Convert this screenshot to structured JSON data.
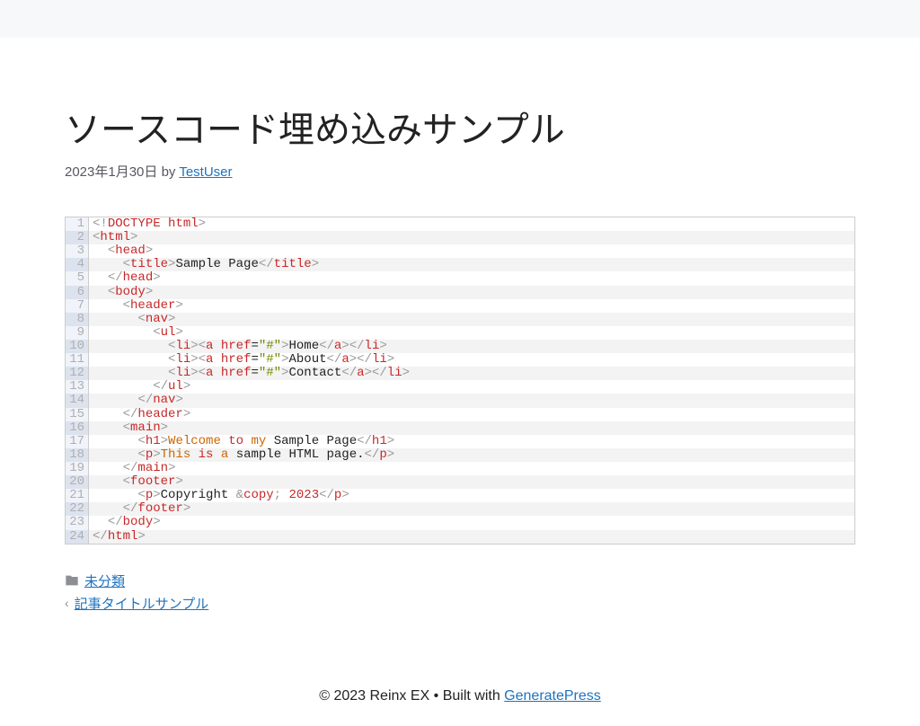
{
  "article": {
    "title": "ソースコード埋め込みサンプル",
    "date": "2023年1月30日",
    "by_label": "by",
    "author": "TestUser"
  },
  "footer_meta": {
    "category": "未分類",
    "prev_post": "記事タイトルサンプル"
  },
  "site_footer": {
    "copyright": "© 2023 Reinx EX",
    "built_with": "Built with",
    "theme": "GeneratePress"
  },
  "code": {
    "line_count": 24,
    "tokens": [
      [
        [
          "ang",
          "<!"
        ],
        [
          "red",
          "DOCTYPE"
        ],
        [
          "plain",
          " "
        ],
        [
          "attr",
          "html"
        ],
        [
          "ang",
          ">"
        ]
      ],
      [
        [
          "ang",
          "<"
        ],
        [
          "red",
          "html"
        ],
        [
          "ang",
          ">"
        ]
      ],
      [
        [
          "plain",
          "  "
        ],
        [
          "ang",
          "<"
        ],
        [
          "red",
          "head"
        ],
        [
          "ang",
          ">"
        ]
      ],
      [
        [
          "plain",
          "    "
        ],
        [
          "ang",
          "<"
        ],
        [
          "red",
          "title"
        ],
        [
          "ang",
          ">"
        ],
        [
          "plain",
          "Sample Page"
        ],
        [
          "ang",
          "</"
        ],
        [
          "red",
          "title"
        ],
        [
          "ang",
          ">"
        ]
      ],
      [
        [
          "plain",
          "  "
        ],
        [
          "ang",
          "</"
        ],
        [
          "red",
          "head"
        ],
        [
          "ang",
          ">"
        ]
      ],
      [
        [
          "plain",
          "  "
        ],
        [
          "ang",
          "<"
        ],
        [
          "red",
          "body"
        ],
        [
          "ang",
          ">"
        ]
      ],
      [
        [
          "plain",
          "    "
        ],
        [
          "ang",
          "<"
        ],
        [
          "red",
          "header"
        ],
        [
          "ang",
          ">"
        ]
      ],
      [
        [
          "plain",
          "      "
        ],
        [
          "ang",
          "<"
        ],
        [
          "red",
          "nav"
        ],
        [
          "ang",
          ">"
        ]
      ],
      [
        [
          "plain",
          "        "
        ],
        [
          "ang",
          "<"
        ],
        [
          "red",
          "ul"
        ],
        [
          "ang",
          ">"
        ]
      ],
      [
        [
          "plain",
          "          "
        ],
        [
          "ang",
          "<"
        ],
        [
          "red",
          "li"
        ],
        [
          "ang",
          "><"
        ],
        [
          "red",
          "a"
        ],
        [
          "plain",
          " "
        ],
        [
          "attr",
          "href"
        ],
        [
          "plain",
          "="
        ],
        [
          "val",
          "\"#\""
        ],
        [
          "ang",
          ">"
        ],
        [
          "plain",
          "Home"
        ],
        [
          "ang",
          "</"
        ],
        [
          "red",
          "a"
        ],
        [
          "ang",
          "></"
        ],
        [
          "red",
          "li"
        ],
        [
          "ang",
          ">"
        ]
      ],
      [
        [
          "plain",
          "          "
        ],
        [
          "ang",
          "<"
        ],
        [
          "red",
          "li"
        ],
        [
          "ang",
          "><"
        ],
        [
          "red",
          "a"
        ],
        [
          "plain",
          " "
        ],
        [
          "attr",
          "href"
        ],
        [
          "plain",
          "="
        ],
        [
          "val",
          "\"#\""
        ],
        [
          "ang",
          ">"
        ],
        [
          "plain",
          "About"
        ],
        [
          "ang",
          "</"
        ],
        [
          "red",
          "a"
        ],
        [
          "ang",
          "></"
        ],
        [
          "red",
          "li"
        ],
        [
          "ang",
          ">"
        ]
      ],
      [
        [
          "plain",
          "          "
        ],
        [
          "ang",
          "<"
        ],
        [
          "red",
          "li"
        ],
        [
          "ang",
          "><"
        ],
        [
          "red",
          "a"
        ],
        [
          "plain",
          " "
        ],
        [
          "attr",
          "href"
        ],
        [
          "plain",
          "="
        ],
        [
          "val",
          "\"#\""
        ],
        [
          "ang",
          ">"
        ],
        [
          "plain",
          "Contact"
        ],
        [
          "ang",
          "</"
        ],
        [
          "red",
          "a"
        ],
        [
          "ang",
          "></"
        ],
        [
          "red",
          "li"
        ],
        [
          "ang",
          ">"
        ]
      ],
      [
        [
          "plain",
          "        "
        ],
        [
          "ang",
          "</"
        ],
        [
          "red",
          "ul"
        ],
        [
          "ang",
          ">"
        ]
      ],
      [
        [
          "plain",
          "      "
        ],
        [
          "ang",
          "</"
        ],
        [
          "red",
          "nav"
        ],
        [
          "ang",
          ">"
        ]
      ],
      [
        [
          "plain",
          "    "
        ],
        [
          "ang",
          "</"
        ],
        [
          "red",
          "header"
        ],
        [
          "ang",
          ">"
        ]
      ],
      [
        [
          "plain",
          "    "
        ],
        [
          "ang",
          "<"
        ],
        [
          "red",
          "main"
        ],
        [
          "ang",
          ">"
        ]
      ],
      [
        [
          "plain",
          "      "
        ],
        [
          "ang",
          "<"
        ],
        [
          "red",
          "h1"
        ],
        [
          "ang",
          ">"
        ],
        [
          "txt",
          "Welcome "
        ],
        [
          "red",
          "to"
        ],
        [
          "txt",
          " my "
        ],
        [
          "plain",
          "Sample Page"
        ],
        [
          "ang",
          "</"
        ],
        [
          "red",
          "h1"
        ],
        [
          "ang",
          ">"
        ]
      ],
      [
        [
          "plain",
          "      "
        ],
        [
          "ang",
          "<"
        ],
        [
          "red",
          "p"
        ],
        [
          "ang",
          ">"
        ],
        [
          "txt",
          "This "
        ],
        [
          "red",
          "is"
        ],
        [
          "txt",
          " a "
        ],
        [
          "plain",
          "sample HTML page."
        ],
        [
          "ang",
          "</"
        ],
        [
          "red",
          "p"
        ],
        [
          "ang",
          ">"
        ]
      ],
      [
        [
          "plain",
          "    "
        ],
        [
          "ang",
          "</"
        ],
        [
          "red",
          "main"
        ],
        [
          "ang",
          ">"
        ]
      ],
      [
        [
          "plain",
          "    "
        ],
        [
          "ang",
          "<"
        ],
        [
          "red",
          "footer"
        ],
        [
          "ang",
          ">"
        ]
      ],
      [
        [
          "plain",
          "      "
        ],
        [
          "ang",
          "<"
        ],
        [
          "red",
          "p"
        ],
        [
          "ang",
          ">"
        ],
        [
          "plain",
          "Copyright "
        ],
        [
          "ang",
          "&"
        ],
        [
          "red",
          "copy"
        ],
        [
          "ang",
          ";"
        ],
        [
          "plain",
          " "
        ],
        [
          "num",
          "2023"
        ],
        [
          "ang",
          "</"
        ],
        [
          "red",
          "p"
        ],
        [
          "ang",
          ">"
        ]
      ],
      [
        [
          "plain",
          "    "
        ],
        [
          "ang",
          "</"
        ],
        [
          "red",
          "footer"
        ],
        [
          "ang",
          ">"
        ]
      ],
      [
        [
          "plain",
          "  "
        ],
        [
          "ang",
          "</"
        ],
        [
          "red",
          "body"
        ],
        [
          "ang",
          ">"
        ]
      ],
      [
        [
          "ang",
          "</"
        ],
        [
          "red",
          "html"
        ],
        [
          "ang",
          ">"
        ]
      ]
    ]
  }
}
